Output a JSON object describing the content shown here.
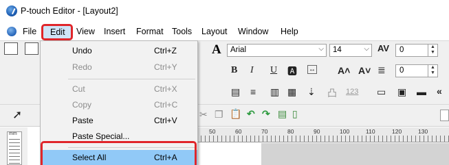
{
  "window": {
    "title": "P-touch Editor - [Layout2]"
  },
  "menubar": {
    "items": [
      "File",
      "Edit",
      "View",
      "Insert",
      "Format",
      "Tools",
      "Layout",
      "Window",
      "Help"
    ],
    "active": "Edit"
  },
  "edit_menu": {
    "items": [
      {
        "label": "Undo",
        "shortcut": "Ctrl+Z",
        "enabled": true
      },
      {
        "label": "Redo",
        "shortcut": "Ctrl+Y",
        "enabled": false
      },
      {
        "label": "Cut",
        "shortcut": "Ctrl+X",
        "enabled": false
      },
      {
        "label": "Copy",
        "shortcut": "Ctrl+C",
        "enabled": false
      },
      {
        "label": "Paste",
        "shortcut": "Ctrl+V",
        "enabled": true
      },
      {
        "label": "Paste Special...",
        "shortcut": "",
        "enabled": true
      },
      {
        "label": "Select All",
        "shortcut": "Ctrl+A",
        "enabled": true,
        "highlighted": true
      }
    ]
  },
  "format_toolbar": {
    "font_name": "Arial",
    "font_size": "14",
    "char_spacing": "0",
    "line_spacing": "0",
    "bold": "B",
    "italic": "I",
    "underline": "U",
    "font_icon_label": "A",
    "more_label": "«"
  },
  "ruler": {
    "unit_label": "mm",
    "numbers": [
      "50",
      "60",
      "70",
      "80",
      "90",
      "100",
      "110",
      "120",
      "130"
    ]
  },
  "colors": {
    "highlight_border": "#e0252a",
    "selected_item": "#91c9f7",
    "menu_bg": "#f2f2f2"
  }
}
